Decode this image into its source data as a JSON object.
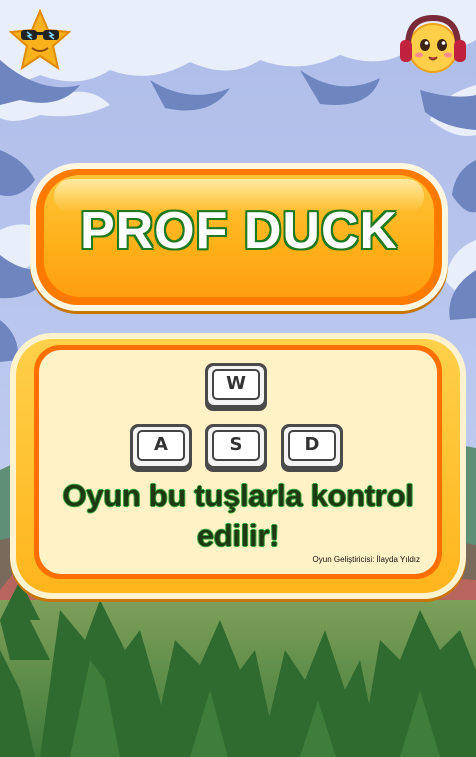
{
  "title": "PROF DUCK",
  "controls": {
    "keys": {
      "up": "W",
      "left": "A",
      "down": "S",
      "right": "D"
    },
    "instruction": "Oyun bu tuşlarla kontrol edilir!",
    "credit": "Oyun Geliştiricisi: İlayda Yıldız"
  },
  "icons": {
    "top_left": "cool-star-icon",
    "top_right": "headphones-emoji-icon"
  },
  "colors": {
    "banner_orange": "#ffb21a",
    "banner_border": "#ff7a00",
    "title_outline": "#1f7a1f",
    "panel_fill": "#fff2c6",
    "sky": "#b9c6ef"
  }
}
